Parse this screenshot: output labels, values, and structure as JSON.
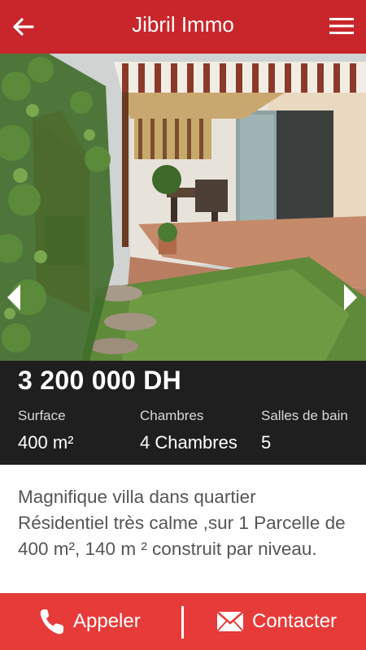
{
  "header": {
    "title": "Jibril Immo",
    "back_icon": "arrow-left-icon",
    "menu_icon": "hamburger-menu-icon"
  },
  "gallery": {
    "prev_icon": "chevron-left-icon",
    "next_icon": "chevron-right-icon"
  },
  "listing": {
    "price": "3 200 000 DH",
    "stats": [
      {
        "label": "Surface",
        "value": "400 m²"
      },
      {
        "label": "Chambres",
        "value": "4 Chambres"
      },
      {
        "label": "Salles de bain",
        "value": "5"
      }
    ],
    "description": "Magnifique villa dans quartier Résidentiel très calme ,sur 1 Parcelle de 400 m², 140 m ² construit par niveau."
  },
  "actions": {
    "call_label": "Appeler",
    "contact_label": "Contacter",
    "call_icon": "phone-icon",
    "contact_icon": "envelope-icon"
  },
  "colors": {
    "header": "#c8262b",
    "bottom_bar": "#e73b3a",
    "info_panel": "#1f1f1f"
  }
}
